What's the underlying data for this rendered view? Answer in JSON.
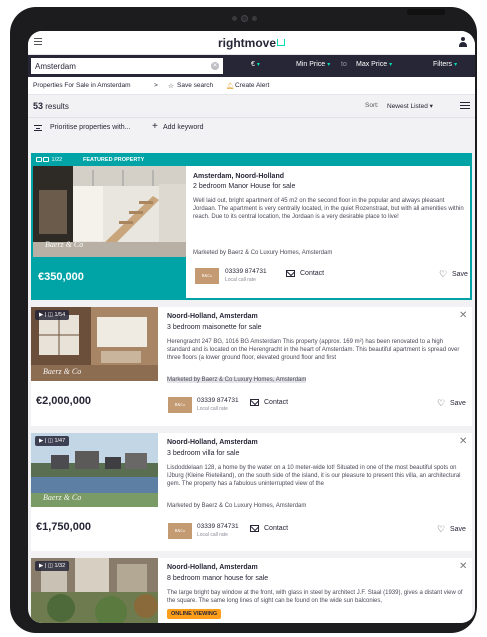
{
  "header": {
    "logo": "rightmove"
  },
  "search": {
    "location_value": "Amsterdam",
    "currency": "€",
    "min_price": "Min Price",
    "to": "to",
    "max_price": "Max Price",
    "filters": "Filters"
  },
  "breadcrumb": {
    "link": "Properties For Sale in Amsterdam",
    "separator": ">",
    "save_search": "Save search",
    "create_alert": "Create Alert"
  },
  "results": {
    "count": "53",
    "label": "results",
    "sort_label": "Sort:",
    "sort_value": "Newest Listed"
  },
  "keyword_bar": {
    "prioritise": "Prioritise properties with...",
    "add_keyword": "Add keyword"
  },
  "listings": [
    {
      "featured": true,
      "feature_label": "FEATURED PROPERTY",
      "photo_count": "1/22",
      "title": "Amsterdam, Noord-Holland",
      "subtitle": "2 bedroom Manor House for sale",
      "description": "Well laid out, bright apartment of 45 m2 on the second floor in the popular and always pleasant Jordaan. The apartment is very centrally located, in the quiet Rozenstraat, but with all amenities within reach. Due to its central location, the Jordaan is a very desirable place to live!",
      "agent": "Marketed by Baerz & Co Luxury Homes, Amsterdam",
      "price": "€350,000",
      "phone": "03339 874731",
      "phone_note": "Local call rate",
      "contact": "Contact",
      "save": "Save",
      "watermark": "Baerz & Co"
    },
    {
      "featured": false,
      "photo_count": "1/54",
      "title": "Noord-Holland, Amsterdam",
      "subtitle": "3 bedroom maisonette for sale",
      "description": "Herengracht 247 BG, 1016 BG Amsterdam This property (approx. 169 m²) has been renovated to a high standard and is located on the Herengracht in the heart of Amsterdam. This beautiful apartment is spread over three floors (a lower ground floor, elevated ground floor and first",
      "agent": "Marketed by Baerz & Co Luxury Homes, Amsterdam",
      "price": "€2,000,000",
      "phone": "03339 874731",
      "phone_note": "Local call rate",
      "contact": "Contact",
      "save": "Save",
      "watermark": "Baerz & Co"
    },
    {
      "featured": false,
      "photo_count": "1/47",
      "title": "Noord-Holland, Amsterdam",
      "subtitle": "3 bedroom villa for sale",
      "description": "Lisdoddelaan 128, a home by the water on a 10 meter-wide lot! Situated in one of the most beautiful spots on IJburg (Kleine Rieteiland), on the south side of the island, it is our pleasure to present this villa, an architectural gem. The property has a fabulous uninterrupted view of the",
      "agent": "Marketed by Baerz & Co Luxury Homes, Amsterdam",
      "price": "€1,750,000",
      "phone": "03339 874731",
      "phone_note": "Local call rate",
      "contact": "Contact",
      "save": "Save",
      "watermark": "Baerz & Co"
    },
    {
      "featured": false,
      "photo_count": "1/32",
      "title": "Noord-Holland, Amsterdam",
      "subtitle": "8 bedroom manor house for sale",
      "description": "The large bright bay window at the front, with glass in steel by architect J.F. Staal (1939), gives a distant view of the square. The same long lines of sight can be found on the wide sun balconies,",
      "badge": "ONLINE VIEWING"
    }
  ],
  "colors": {
    "brand_dark": "#262637",
    "teal": "#00a4a6",
    "accent": "#00deb6",
    "badge_orange": "#ff9e1b"
  }
}
